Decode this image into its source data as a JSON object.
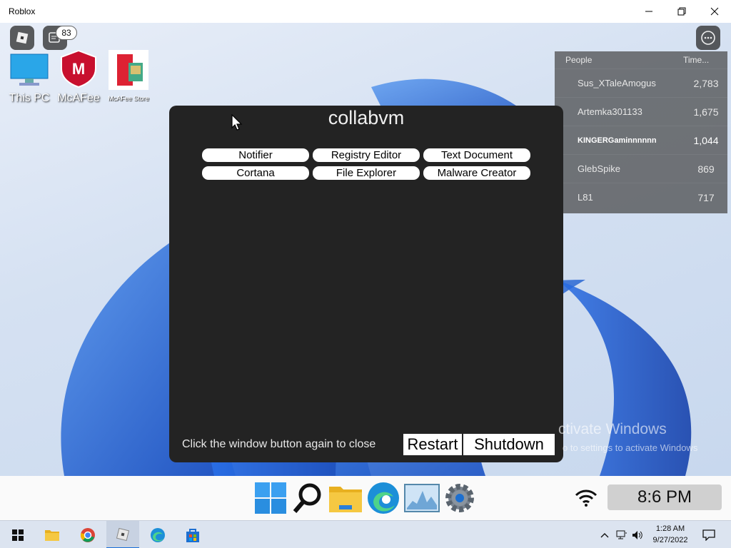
{
  "window": {
    "title": "Roblox"
  },
  "hud": {
    "chat_count": "83"
  },
  "desktop_icons": [
    {
      "label": "This PC"
    },
    {
      "label": "McAFee"
    },
    {
      "label": "McAFee Store"
    }
  ],
  "leaderboard": {
    "header_people": "People",
    "header_stat": "Time...",
    "rows": [
      {
        "name": "Sus_XTaleAmogus",
        "value": "2,783"
      },
      {
        "name": "Artemka301133",
        "value": "1,675"
      },
      {
        "name": "KINGERGaminnnnnn",
        "value": "1,044"
      },
      {
        "name": "GlebSpike",
        "value": "869"
      },
      {
        "name": "L81",
        "value": "717"
      }
    ]
  },
  "collabvm": {
    "title": "collabvm",
    "buttons": [
      "Notifier",
      "Registry Editor",
      "Text Document",
      "Cortana",
      "File Explorer",
      "Malware Creator"
    ],
    "hint": "Click the window button again to close",
    "restart": "Restart",
    "shutdown": "Shutdown"
  },
  "watermark": {
    "line1": "ctivate Windows",
    "line2": "o to settings to activate Windows"
  },
  "game_taskbar": {
    "clock": "8:6 PM"
  },
  "system_tray": {
    "time": "1:28 AM",
    "date": "9/27/2022"
  },
  "colors": {
    "accent": "#1b6fd8",
    "panel": "#232323",
    "bloom": "#1f5fd6"
  }
}
